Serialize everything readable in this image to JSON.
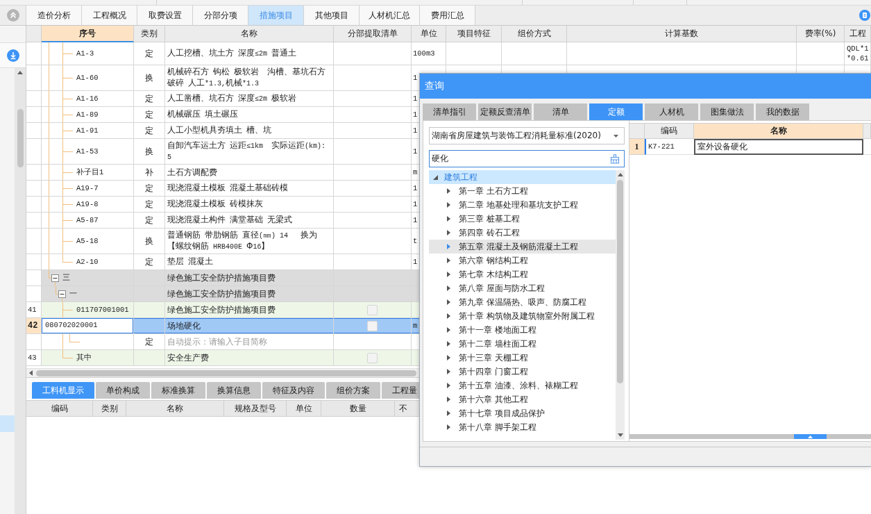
{
  "tabs": [
    {
      "label": "造价分析",
      "selected": false
    },
    {
      "label": "工程概况",
      "selected": false
    },
    {
      "label": "取费设置",
      "selected": false
    },
    {
      "label": "分部分项",
      "selected": false
    },
    {
      "label": "措施项目",
      "selected": true
    },
    {
      "label": "其他项目",
      "selected": false
    },
    {
      "label": "人材机汇总",
      "selected": false
    },
    {
      "label": "费用汇总",
      "selected": false
    }
  ],
  "sidebar": {
    "items": [
      {
        "selected": true
      }
    ]
  },
  "table": {
    "columns": [
      {
        "label": "序号",
        "selected": true
      },
      {
        "label": "类别",
        "selected": false
      },
      {
        "label": "名称",
        "selected": false
      },
      {
        "label": "分部提取清单",
        "selected": false
      },
      {
        "label": "单位",
        "selected": false
      },
      {
        "label": "项目特征",
        "selected": false
      },
      {
        "label": "组价方式",
        "selected": false
      },
      {
        "label": "计算基数",
        "selected": false
      },
      {
        "label": "费率(%)",
        "selected": false
      },
      {
        "label": "工程",
        "selected": false
      }
    ],
    "rows": [
      {
        "kind": "continued",
        "children": [
          {
            "kind": "continued",
            "children": [
              {
                "kind": "sub",
                "code": "A1-3",
                "type": "定",
                "name": "人工挖槽、坑土方 深度≤2m 普通土",
                "unit": "100m3",
                "column_10": "QDL*1\n*0.61",
                "selected": false
              },
              {
                "kind": "sub",
                "code": "A1-60",
                "type": "换",
                "name": "机械碎石方 钩松 极软岩  沟槽、基坑石方破碎 人工*1.3,机械*1.3",
                "unit": "1",
                "selected": false
              },
              {
                "kind": "sub",
                "code": "A1-16",
                "type": "定",
                "name": "人工凿槽、坑石方 深度≤2m 极软岩",
                "unit": "1",
                "selected": false
              },
              {
                "kind": "sub",
                "code": "A1-89",
                "type": "定",
                "name": "机械碾压 填土碾压",
                "unit": "1",
                "selected": false
              },
              {
                "kind": "sub",
                "code": "A1-91",
                "type": "定",
                "name": "人工小型机具夯填土 槽、坑",
                "unit": "1",
                "selected": false
              },
              {
                "kind": "sub",
                "code": "A1-53",
                "type": "换",
                "name": "自卸汽车运土方 运距≤1km  实际运距(km):5",
                "unit": "1",
                "selected": false
              },
              {
                "kind": "sub",
                "code": "补子目1",
                "type": "补",
                "name": "土石方调配费",
                "unit": "m",
                "selected": false
              },
              {
                "kind": "sub",
                "code": "A19-7",
                "type": "定",
                "name": "现浇混凝土模板 混凝土基础砖模",
                "unit": "1",
                "selected": false
              },
              {
                "kind": "sub",
                "code": "A19-8",
                "type": "定",
                "name": "现浇混凝土模板 砖模抹灰",
                "unit": "1",
                "selected": false
              },
              {
                "kind": "sub",
                "code": "A5-87",
                "type": "定",
                "name": "现浇混凝土构件 满堂基础 无梁式",
                "unit": "1",
                "selected": false
              },
              {
                "kind": "sub",
                "code": "A5-18",
                "type": "换",
                "name": "普通钢筋 带肋钢筋 直径(㎜) 14   换为【螺纹钢筋 HRB400E Φ16】",
                "unit": "t",
                "selected": false
              },
              {
                "kind": "sub",
                "code": "A2-10",
                "type": "定",
                "name": "垫层 混凝土",
                "unit": "1",
                "selected": false
              }
            ]
          }
        ]
      },
      {
        "kind": "section",
        "code": "三",
        "name": "绿色施工安全防护措施项目费",
        "expanded": true,
        "selected": false,
        "children": [
          {
            "kind": "section",
            "code": "一",
            "name": "绿色施工安全防护措施项目费",
            "expanded": true,
            "selected": false,
            "children": [
              {
                "kind": "item",
                "number": "41",
                "code": "011707001001",
                "name": "绿色施工安全防护措施项目费",
                "extract_checked": false,
                "selected": false
              },
              {
                "kind": "item",
                "number": "42",
                "code": "080702020001",
                "name": "场地硬化",
                "extract_checked": false,
                "unit": "m",
                "selected": true,
                "children": [
                  {
                    "kind": "hint",
                    "type": "定",
                    "name": "自动提示：请输入子目简称",
                    "selected": false
                  }
                ]
              },
              {
                "kind": "item",
                "number": "43",
                "code": "其中",
                "name": "安全生产费",
                "extract_checked": false,
                "selected": false
              }
            ]
          }
        ]
      }
    ]
  },
  "detail_panel": {
    "tabs": [
      {
        "label": "工料机显示",
        "selected": true
      },
      {
        "label": "单价构成",
        "selected": false
      },
      {
        "label": "标准换算",
        "selected": false
      },
      {
        "label": "换算信息",
        "selected": false
      },
      {
        "label": "特征及内容",
        "selected": false
      },
      {
        "label": "组价方案",
        "selected": false
      },
      {
        "label": "工程量",
        "selected": false
      }
    ],
    "columns": [
      "编码",
      "类别",
      "名称",
      "规格及型号",
      "单位",
      "数量",
      "不"
    ]
  },
  "dialog": {
    "title": "查询",
    "tabs": [
      {
        "label": "清单指引",
        "selected": false
      },
      {
        "label": "定额反查清单",
        "selected": false
      },
      {
        "label": "清单",
        "selected": false
      },
      {
        "label": "定额",
        "selected": true
      },
      {
        "label": "人材机",
        "selected": false
      },
      {
        "label": "图集做法",
        "selected": false
      },
      {
        "label": "我的数据",
        "selected": false
      }
    ],
    "library": "湖南省房屋建筑与装饰工程消耗量标准(2020)",
    "search": {
      "value": "硬化"
    },
    "tree": [
      {
        "label": "建筑工程",
        "expanded": true,
        "selected": true,
        "hovered": false,
        "children": [
          {
            "label": "第一章 土石方工程",
            "expanded": false,
            "selected": false,
            "hovered": false
          },
          {
            "label": "第二章 地基处理和基坑支护工程",
            "expanded": false,
            "selected": false,
            "hovered": false
          },
          {
            "label": "第三章 桩基工程",
            "expanded": false,
            "selected": false,
            "hovered": false
          },
          {
            "label": "第四章 砖石工程",
            "expanded": false,
            "selected": false,
            "hovered": false
          },
          {
            "label": "第五章 混凝土及钢筋混凝土工程",
            "expanded": false,
            "selected": false,
            "hovered": true
          },
          {
            "label": "第六章 钢结构工程",
            "expanded": false,
            "selected": false,
            "hovered": false
          },
          {
            "label": "第七章 木结构工程",
            "expanded": false,
            "selected": false,
            "hovered": false
          },
          {
            "label": "第八章 屋面与防水工程",
            "expanded": false,
            "selected": false,
            "hovered": false
          },
          {
            "label": "第九章 保温隔热、吸声、防腐工程",
            "expanded": false,
            "selected": false,
            "hovered": false
          },
          {
            "label": "第十章 构筑物及建筑物室外附属工程",
            "expanded": false,
            "selected": false,
            "hovered": false
          },
          {
            "label": "第十一章 楼地面工程",
            "expanded": false,
            "selected": false,
            "hovered": false
          },
          {
            "label": "第十二章 墙柱面工程",
            "expanded": false,
            "selected": false,
            "hovered": false
          },
          {
            "label": "第十三章 天棚工程",
            "expanded": false,
            "selected": false,
            "hovered": false
          },
          {
            "label": "第十四章 门窗工程",
            "expanded": false,
            "selected": false,
            "hovered": false
          },
          {
            "label": "第十五章 油漆、涂料、裱糊工程",
            "expanded": false,
            "selected": false,
            "hovered": false
          },
          {
            "label": "第十六章 其他工程",
            "expanded": false,
            "selected": false,
            "hovered": false
          },
          {
            "label": "第十七章 项目成品保护",
            "expanded": false,
            "selected": false,
            "hovered": false
          },
          {
            "label": "第十八章 脚手架工程",
            "expanded": false,
            "selected": false,
            "hovered": false
          }
        ]
      }
    ],
    "results": {
      "columns": [
        {
          "label": "编码",
          "selected": false
        },
        {
          "label": "名称",
          "selected": true
        }
      ],
      "rows": [
        {
          "number": "1",
          "code": "K7-221",
          "name": "室外设备硬化",
          "selected": true
        }
      ]
    }
  }
}
